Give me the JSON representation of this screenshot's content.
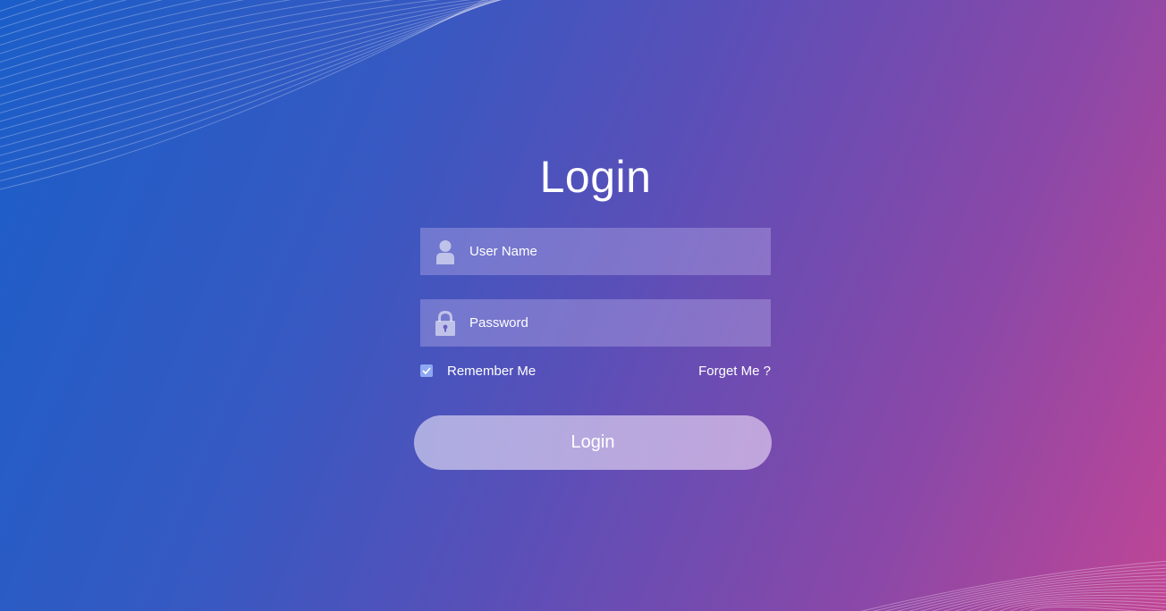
{
  "form": {
    "title": "Login",
    "username": {
      "value": "",
      "placeholder": "User Name",
      "icon": "user-icon"
    },
    "password": {
      "value": "",
      "placeholder": "Password",
      "icon": "lock-icon"
    },
    "remember": {
      "label": "Remember Me",
      "checked": true
    },
    "forget_label": "Forget Me ?",
    "submit_label": "Login"
  },
  "colors": {
    "gradient_start": "#1b5ec9",
    "gradient_mid": "#5a4fb8",
    "gradient_end": "#c04595",
    "checkbox": "#8ea8f2"
  }
}
